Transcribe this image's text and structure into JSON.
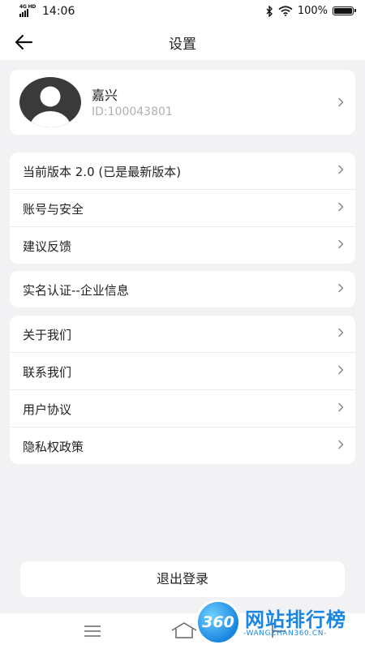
{
  "status_bar": {
    "time": "14:06",
    "network": "4G HD",
    "battery_text": "100%",
    "battery_level": 1.0
  },
  "header": {
    "title": "设置"
  },
  "profile": {
    "name": "嘉兴",
    "id_text": "ID:100043801"
  },
  "groups": [
    {
      "items": [
        {
          "label": "当前版本 2.0 (已是最新版本)"
        },
        {
          "label": "账号与安全"
        },
        {
          "label": "建议反馈"
        }
      ]
    },
    {
      "items": [
        {
          "label": "实名认证--企业信息"
        }
      ]
    },
    {
      "items": [
        {
          "label": "关于我们"
        },
        {
          "label": "联系我们"
        },
        {
          "label": "用户协议"
        },
        {
          "label": "隐私权政策"
        }
      ]
    }
  ],
  "logout_label": "退出登录",
  "watermark": {
    "badge": "360",
    "title": "网站排行榜",
    "subtitle": "-WANGZHAN360.CN-"
  },
  "colors": {
    "background": "#f2f2f4",
    "card": "#ffffff",
    "secondary_text": "#b0b0b0",
    "watermark": "#1a86e0"
  },
  "icons": [
    "back-arrow-icon",
    "chevron-right-icon",
    "avatar-placeholder-icon",
    "bluetooth-icon",
    "wifi-icon",
    "battery-icon",
    "signal-icon",
    "menu-icon",
    "home-icon",
    "back-icon"
  ]
}
